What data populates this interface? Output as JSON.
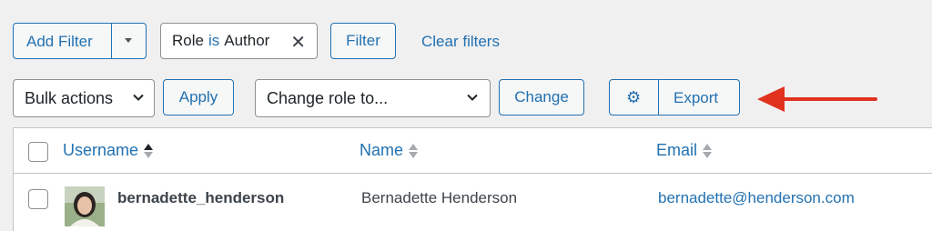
{
  "filters": {
    "add_filter_label": "Add Filter",
    "chip": {
      "field": "Role",
      "operator": "is",
      "value": "Author"
    },
    "filter_button": "Filter",
    "clear_link": "Clear filters"
  },
  "bulk": {
    "bulk_select": "Bulk actions",
    "apply_button": "Apply",
    "role_select": "Change role to...",
    "change_button": "Change",
    "export_button": "Export"
  },
  "table": {
    "columns": [
      "Username",
      "Name",
      "Email"
    ],
    "rows": [
      {
        "username": "bernadette_henderson",
        "name": "Bernadette Henderson",
        "email": "bernadette@henderson.com"
      }
    ]
  },
  "colors": {
    "accent": "#2271b1",
    "annotation_arrow": "#e0321f"
  },
  "icons": [
    "caret-down-icon",
    "close-icon",
    "chevron-down-icon",
    "gear-icon",
    "sort-icon",
    "arrow-left-icon"
  ]
}
